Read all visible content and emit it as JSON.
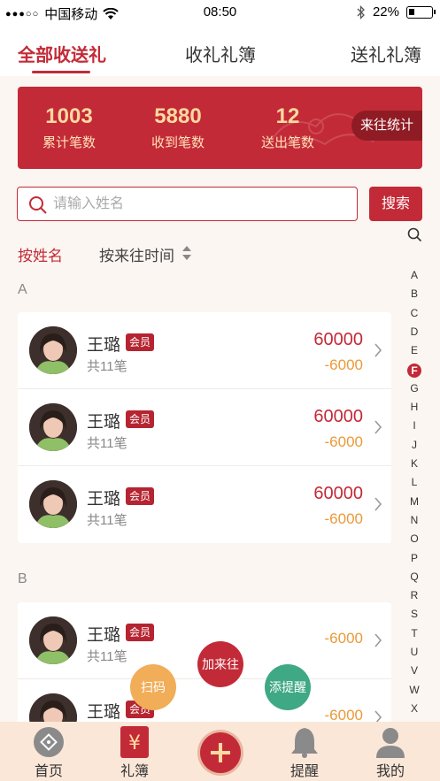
{
  "status": {
    "carrier": "中国移动",
    "signal": "●●●○○",
    "time": "08:50",
    "battery": "22%"
  },
  "tabs": [
    {
      "label": "全部收送礼",
      "active": true
    },
    {
      "label": "收礼礼簿",
      "active": false
    },
    {
      "label": "送礼礼簿",
      "active": false
    }
  ],
  "stats": {
    "total": {
      "value": "1003",
      "label": "累计笔数"
    },
    "received": {
      "value": "5880",
      "label": "收到笔数"
    },
    "sent": {
      "value": "12",
      "label": "送出笔数"
    },
    "button": "来往统计"
  },
  "search": {
    "placeholder": "请输入姓名",
    "button": "搜索"
  },
  "sort": {
    "by_name": "按姓名",
    "by_time": "按来往时间"
  },
  "sections": [
    {
      "letter": "A",
      "rows": [
        {
          "name": "王璐",
          "badge": "会员",
          "count": "共11笔",
          "in": "60000",
          "out": "-6000"
        },
        {
          "name": "王璐",
          "badge": "会员",
          "count": "共11笔",
          "in": "60000",
          "out": "-6000"
        },
        {
          "name": "王璐",
          "badge": "会员",
          "count": "共11笔",
          "in": "60000",
          "out": "-6000"
        }
      ]
    },
    {
      "letter": "B",
      "rows": [
        {
          "name": "王璐",
          "badge": "会员",
          "count": "共11笔",
          "in": "",
          "out": "-6000"
        },
        {
          "name": "王璐",
          "badge": "会员",
          "count": "",
          "in": "",
          "out": "-6000"
        }
      ]
    }
  ],
  "index": [
    "A",
    "B",
    "C",
    "D",
    "E",
    "F",
    "G",
    "H",
    "I",
    "J",
    "K",
    "L",
    "M",
    "N",
    "O",
    "P",
    "Q",
    "R",
    "S",
    "T",
    "U",
    "V",
    "W",
    "X"
  ],
  "index_active": "F",
  "fab": {
    "add": "加来往",
    "scan": "扫码",
    "remind": "添提醒"
  },
  "nav": [
    {
      "label": "首页",
      "icon": "home-icon"
    },
    {
      "label": "礼簿",
      "icon": "gift-book-icon"
    },
    {
      "label": "",
      "icon": "plus-icon"
    },
    {
      "label": "提醒",
      "icon": "bell-icon"
    },
    {
      "label": "我的",
      "icon": "user-icon"
    }
  ],
  "colors": {
    "primary": "#c32a37",
    "accent": "#e99a3a",
    "scan": "#f1ad57",
    "remind": "#3fa884"
  }
}
